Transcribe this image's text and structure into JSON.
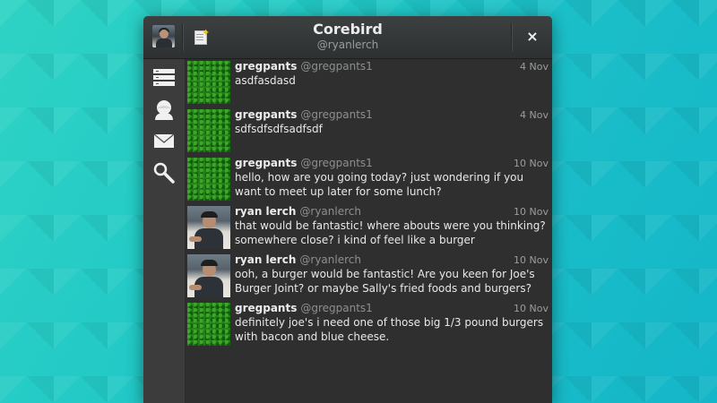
{
  "window": {
    "title": "Corebird",
    "subtitle": "@ryanlerch",
    "close_label": "×"
  },
  "sidebar": {
    "items": [
      {
        "name": "timeline",
        "icon": "stream-icon"
      },
      {
        "name": "mentions",
        "icon": "user-icon"
      },
      {
        "name": "messages",
        "icon": "envelope-icon"
      },
      {
        "name": "search",
        "icon": "search-icon"
      }
    ]
  },
  "tweets": [
    {
      "name": "gregpants",
      "handle": "@gregpants1",
      "date": "4 Nov",
      "text": "asdfasdasd",
      "avatar": "grass"
    },
    {
      "name": "gregpants",
      "handle": "@gregpants1",
      "date": "4 Nov",
      "text": "sdfsdfsdfsadfsdf",
      "avatar": "grass"
    },
    {
      "name": "gregpants",
      "handle": "@gregpants1",
      "date": "10 Nov",
      "text": "hello, how are you going today? just wondering if you want to meet up later for some lunch?",
      "avatar": "grass"
    },
    {
      "name": "ryan lerch",
      "handle": "@ryanlerch",
      "date": "10 Nov",
      "text": "that would be fantastic! where abouts were you thinking? somewhere close? i kind of feel like a burger",
      "avatar": "person"
    },
    {
      "name": "ryan lerch",
      "handle": "@ryanlerch",
      "date": "10 Nov",
      "text": "ooh, a burger would be fantastic! Are you keen for Joe's Burger Joint? or maybe Sally's fried foods and burgers?",
      "avatar": "person"
    },
    {
      "name": "gregpants",
      "handle": "@gregpants1",
      "date": "10 Nov",
      "text": "definitely joe's i need one of those big 1/3 pound burgers with bacon and blue cheese.",
      "avatar": "grass"
    }
  ]
}
